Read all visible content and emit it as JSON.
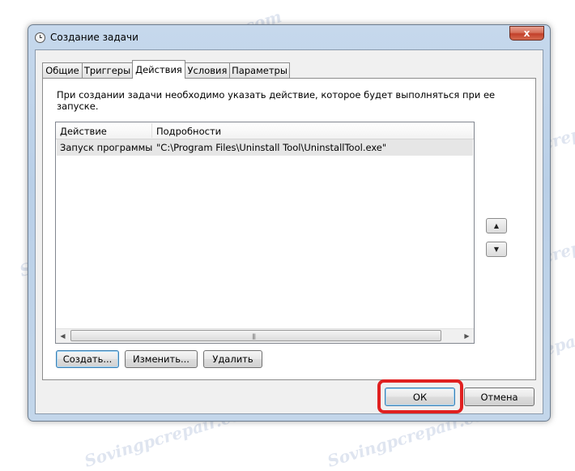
{
  "window": {
    "title": "Создание задачи",
    "close_label": "x"
  },
  "tabs": [
    {
      "label": "Общие"
    },
    {
      "label": "Триггеры"
    },
    {
      "label": "Действия",
      "active": true
    },
    {
      "label": "Условия"
    },
    {
      "label": "Параметры"
    }
  ],
  "actions_panel": {
    "description": "При создании задачи необходимо указать действие, которое будет выполняться при ее запуске.",
    "columns": [
      "Действие",
      "Подробности"
    ],
    "rows": [
      {
        "action": "Запуск программы",
        "details": "\"C:\\Program Files\\Uninstall Tool\\UninstallTool.exe\""
      }
    ],
    "move_up_icon": "triangle-up-icon",
    "move_down_icon": "triangle-down-icon",
    "buttons": {
      "create": "Создать...",
      "edit": "Изменить...",
      "delete": "Удалить"
    }
  },
  "footer": {
    "ok": "ОК",
    "cancel": "Отмена"
  },
  "highlight": {
    "target": "ok-button",
    "color": "#e02020"
  },
  "watermark_text": "Sovingpcrepair.com"
}
